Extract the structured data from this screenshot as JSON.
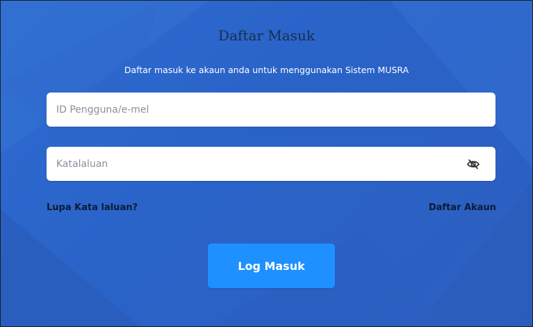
{
  "login": {
    "title": "Daftar Masuk",
    "subtitle": "Daftar masuk ke akaun anda untuk menggunakan Sistem MUSRA",
    "username": {
      "placeholder": "ID Pengguna/e-mel",
      "value": ""
    },
    "password": {
      "placeholder": "Katalaluan",
      "value": "",
      "toggle_icon": "eye-slash-icon"
    },
    "forgot_password_label": "Lupa Kata laluan?",
    "register_label": "Daftar Akaun",
    "submit_label": "Log Masuk"
  },
  "colors": {
    "background": "#2a63c8",
    "button": "#1e90ff",
    "title": "#1c2b4a",
    "link": "#0d1b33"
  }
}
